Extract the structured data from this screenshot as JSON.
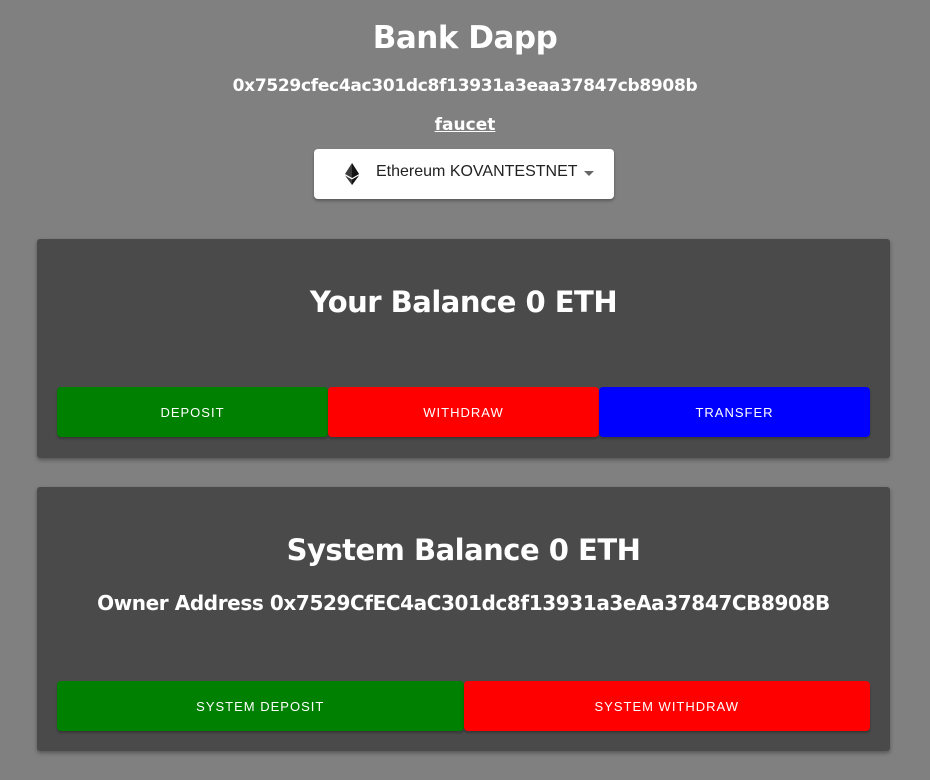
{
  "header": {
    "title": "Bank Dapp",
    "account_address": "0x7529cfec4ac301dc8f13931a3eaa37847cb8908b",
    "faucet_label": "faucet"
  },
  "network_select": {
    "icon": "ethereum-icon",
    "selected": "Ethereum KOVANTESTNET"
  },
  "user_card": {
    "balance_text": "Your Balance 0 ETH",
    "buttons": {
      "deposit": "DEPOSIT",
      "withdraw": "WITHDRAW",
      "transfer": "TRANSFER"
    }
  },
  "system_card": {
    "balance_text": "System Balance 0 ETH",
    "owner_text": "Owner Address 0x7529CfEC4aC301dc8f13931a3eAa37847CB8908B",
    "buttons": {
      "deposit": "SYSTEM DEPOSIT",
      "withdraw": "SYSTEM WITHDRAW"
    }
  },
  "colors": {
    "page_background": "#808080",
    "card_background": "#4a4a4a",
    "deposit": "#008000",
    "withdraw": "#ff0000",
    "transfer": "#0000ff"
  }
}
